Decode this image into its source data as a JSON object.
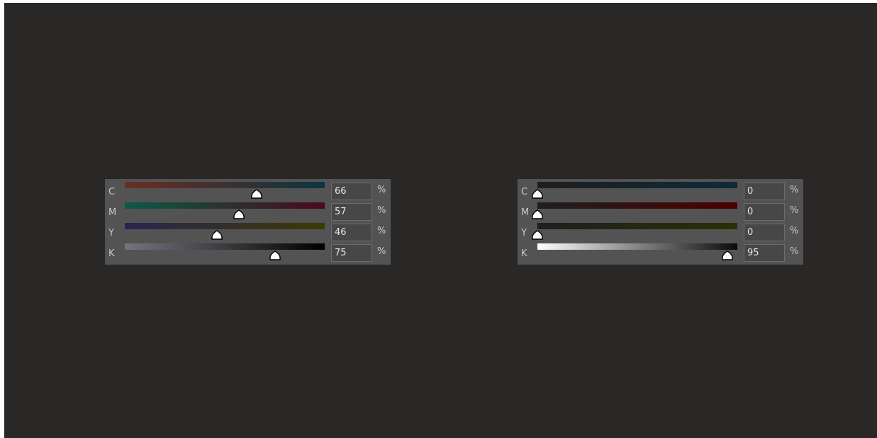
{
  "panels": [
    {
      "channels": [
        {
          "label": "C",
          "value": "66",
          "unit": "%",
          "level": 0.66,
          "gradient": [
            "#6b2e22",
            "#0c3540"
          ]
        },
        {
          "label": "M",
          "value": "57",
          "unit": "%",
          "level": 0.57,
          "gradient": [
            "#0b5a47",
            "#4a0a1a"
          ]
        },
        {
          "label": "Y",
          "value": "46",
          "unit": "%",
          "level": 0.46,
          "gradient": [
            "#2c2450",
            "#3b3a05"
          ]
        },
        {
          "label": "K",
          "value": "75",
          "unit": "%",
          "level": 0.75,
          "gradient": [
            "#75747e",
            "#000000"
          ]
        }
      ]
    },
    {
      "channels": [
        {
          "label": "C",
          "value": "0",
          "unit": "%",
          "level": 0.0,
          "gradient": [
            "#1f1f1f",
            "#0d2a38"
          ]
        },
        {
          "label": "M",
          "value": "0",
          "unit": "%",
          "level": 0.0,
          "gradient": [
            "#1f1f1f",
            "#4a0000"
          ]
        },
        {
          "label": "Y",
          "value": "0",
          "unit": "%",
          "level": 0.0,
          "gradient": [
            "#1f1f1f",
            "#2c2e05"
          ]
        },
        {
          "label": "K",
          "value": "95",
          "unit": "%",
          "level": 0.95,
          "gradient": [
            "#ffffff",
            "#0a0a0a"
          ]
        }
      ]
    }
  ]
}
